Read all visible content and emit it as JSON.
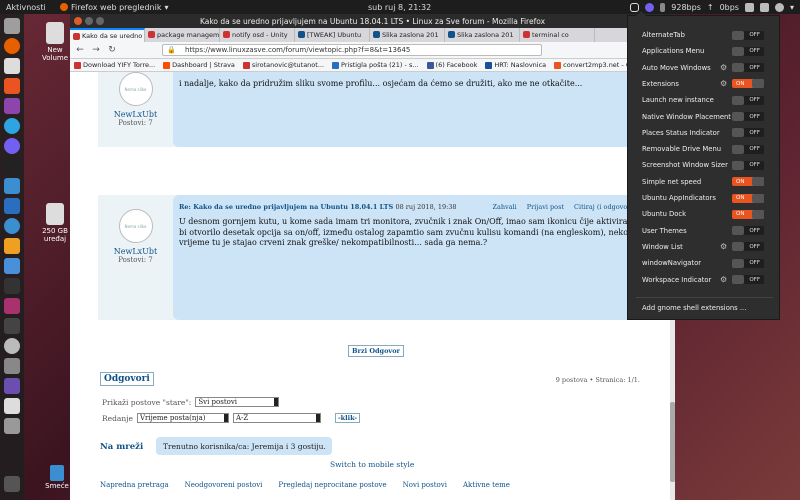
{
  "topbar": {
    "activities": "Aktivnosti",
    "app_name": "Firefox web preglednik",
    "clock": "sub ruj  8, 21:32",
    "net_down": "928bps",
    "net_up": "0bps"
  },
  "desktop": {
    "new_volume": "New Volume",
    "volume_250": "250 GB uređaj",
    "trash": "Smeće"
  },
  "firefox": {
    "window_title": "Kako da se uredno prijavljujem na Ubuntu 18.04.1 LTS • Linux za Sve forum - Mozilla Firefox",
    "tabs": [
      {
        "label": "Kako da se uredno",
        "active": true
      },
      {
        "label": "package managem",
        "active": false
      },
      {
        "label": "notify osd - Unity",
        "active": false
      },
      {
        "label": "[TWEAK] Ubuntu",
        "active": false
      },
      {
        "label": "Slika zaslona 201",
        "active": false
      },
      {
        "label": "Slika zaslona 201",
        "active": false
      },
      {
        "label": "terminal co",
        "active": false
      }
    ],
    "url": "https://www.linuxzasve.com/forum/viewtopic.php?f=8&t=13645",
    "bookmarks": [
      "Download YIFY Torre...",
      "Dashboard | Strava",
      "sirotanovic@tutanot...",
      "Pristigla pošta (21) - s...",
      "(6) Facebook",
      "HRT: Naslovnica",
      "convert2mp3.net - Co..."
    ]
  },
  "forum": {
    "post1": {
      "avatar_text": "Nema slike",
      "username": "NewLxUbt",
      "posts_label": "Postovi: 7",
      "text": "i nadalje, kako da pridružim sliku svome profilu... osjećam da ćemo se družiti, ako me ne otkačite..."
    },
    "post2": {
      "avatar_text": "Nema slike",
      "username": "NewLxUbt",
      "posts_label": "Postovi: 7",
      "subject": "Re: Kako da se uredno prijavljujem na Ubuntu 18.04.1 LTS",
      "date": "08 ruj 2018, 19:38",
      "actions": [
        "Zahvali",
        "Prijavi post",
        "Citiraj (i odgovori)"
      ],
      "lines": [
        "U desnom gornjem kutu, u kome sada imam tri monitora, zvučnik i znak On/Off, imao sam ikonicu čije aktiviranje",
        "bi otvorilo desetak opcija sa on/off, između ostalog zapamtio sam zvučnu kulisu komandi (na engleskom), neko",
        "vrijeme tu je stajao crveni znak greške/ nekompatibilnosti... sada ga nema.?"
      ]
    },
    "quick_reply": "Brzi Odgovor",
    "reply_title": "Odgovori",
    "reply_stats": "9 postova • Stranica: 1/1.",
    "show_posts_label": "Prikaži postove \"stare\":",
    "show_posts_value": "Svi postovi",
    "sort_label": "Redanje",
    "sort_value": "Vrijeme posta(nja)",
    "order_value": "A-Z",
    "go_button": "-klik-",
    "online_title": "Na mreži",
    "online_text": "Trenutno korisnika/ca: Jeremija i 3 gostiju.",
    "mobile_link": "Switch to mobile style",
    "footer_links": [
      "Napredna pretraga",
      "Neodgovoreni postovi",
      "Pregledaj neprocitane postove",
      "Novi postovi",
      "Aktivne teme"
    ]
  },
  "extensions": {
    "items": [
      {
        "name": "AlternateTab",
        "state": "OFF",
        "gear": false
      },
      {
        "name": "Applications Menu",
        "state": "OFF",
        "gear": false
      },
      {
        "name": "Auto Move Windows",
        "state": "OFF",
        "gear": true
      },
      {
        "name": "Extensions",
        "state": "ON",
        "gear": true
      },
      {
        "name": "Launch new instance",
        "state": "OFF",
        "gear": false
      },
      {
        "name": "Native Window Placement",
        "state": "OFF",
        "gear": false
      },
      {
        "name": "Places Status Indicator",
        "state": "OFF",
        "gear": false
      },
      {
        "name": "Removable Drive Menu",
        "state": "OFF",
        "gear": false
      },
      {
        "name": "Screenshot Window Sizer",
        "state": "OFF",
        "gear": false
      },
      {
        "name": "Simple net speed",
        "state": "ON",
        "gear": false
      },
      {
        "name": "Ubuntu AppIndicators",
        "state": "ON",
        "gear": false
      },
      {
        "name": "Ubuntu Dock",
        "state": "ON",
        "gear": false
      },
      {
        "name": "User Themes",
        "state": "OFF",
        "gear": false
      },
      {
        "name": "Window List",
        "state": "OFF",
        "gear": true
      },
      {
        "name": "windowNavigator",
        "state": "OFF",
        "gear": false
      },
      {
        "name": "Workspace Indicator",
        "state": "OFF",
        "gear": true
      }
    ],
    "footer": "Add gnome shell extensions ..."
  },
  "colors": {
    "accent": "#e95420",
    "link": "#105289",
    "bubble": "#cde4f7"
  }
}
